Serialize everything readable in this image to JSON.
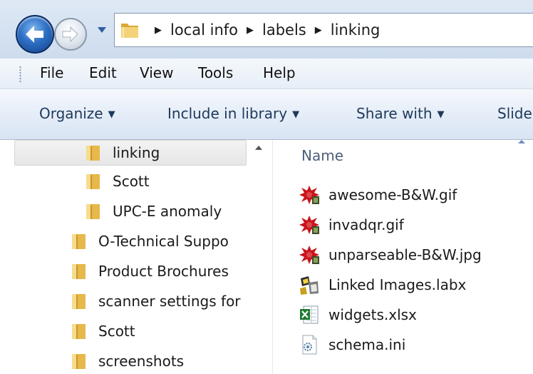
{
  "window": {
    "breadcrumb": [
      "local info",
      "labels",
      "linking"
    ]
  },
  "menu": {
    "items": [
      "File",
      "Edit",
      "View",
      "Tools",
      "Help"
    ]
  },
  "commands": {
    "items": [
      "Organize",
      "Include in library",
      "Share with",
      "Slide"
    ]
  },
  "nav_tree": {
    "items": [
      {
        "label": "linking",
        "selected": true
      },
      {
        "label": "Scott"
      },
      {
        "label": "UPC-E anomaly"
      },
      {
        "label": "O-Technical Suppo"
      },
      {
        "label": "Product Brochures"
      },
      {
        "label": "scanner settings for"
      },
      {
        "label": "Scott"
      },
      {
        "label": "screenshots"
      }
    ]
  },
  "file_list": {
    "column_name": "Name",
    "files": [
      {
        "name": "awesome-B&W.gif",
        "icon": "splat-image-icon"
      },
      {
        "name": "invadqr.gif",
        "icon": "splat-image-icon"
      },
      {
        "name": "unparseable-B&W.jpg",
        "icon": "splat-image-icon"
      },
      {
        "name": "Linked Images.labx",
        "icon": "label-app-icon"
      },
      {
        "name": "widgets.xlsx",
        "icon": "excel-icon"
      },
      {
        "name": "schema.ini",
        "icon": "ini-settings-icon"
      }
    ]
  },
  "colors": {
    "toolbar_text": "#1e395b",
    "folder": "#e8c35a",
    "splat": "#c8161d",
    "excel": "#1e7a32"
  }
}
